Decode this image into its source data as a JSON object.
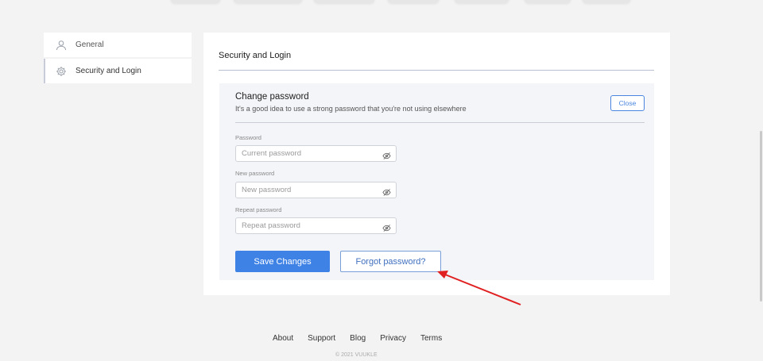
{
  "sidebar": {
    "items": [
      {
        "label": "General",
        "icon": "user-icon"
      },
      {
        "label": "Security and Login",
        "icon": "gear-icon"
      }
    ]
  },
  "main": {
    "title": "Security and Login",
    "panel": {
      "title": "Change password",
      "subtitle": "It's a good idea to use a strong password that you're not using elsewhere",
      "close_label": "Close",
      "fields": [
        {
          "label": "Password",
          "placeholder": "Current password",
          "icon": "eye-slash-icon"
        },
        {
          "label": "New password",
          "placeholder": "New password",
          "icon": "eye-slash-icon"
        },
        {
          "label": "Repeat password",
          "placeholder": "Repeat password",
          "icon": "eye-slash-icon"
        }
      ],
      "save_label": "Save Changes",
      "forgot_label": "Forgot password?"
    }
  },
  "footer": {
    "links": [
      "About",
      "Support",
      "Blog",
      "Privacy",
      "Terms"
    ],
    "copyright": "© 2021 VUUKLE"
  },
  "colors": {
    "accent": "#3f82e6",
    "annotation_arrow": "#e02020"
  }
}
